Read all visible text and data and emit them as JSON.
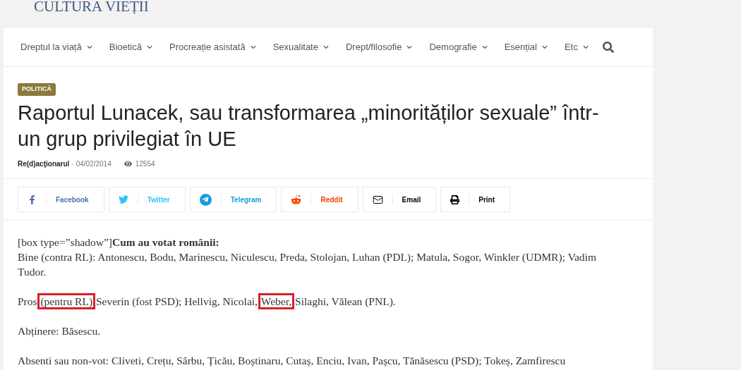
{
  "logo": "CULTURA VIEȚII",
  "nav": {
    "items": [
      {
        "label": "Dreptul la viață"
      },
      {
        "label": "Bioetică"
      },
      {
        "label": "Procreație asistată"
      },
      {
        "label": "Sexualitate"
      },
      {
        "label": "Drept/filosofie"
      },
      {
        "label": "Demografie"
      },
      {
        "label": "Esențial"
      },
      {
        "label": "Etc"
      }
    ]
  },
  "article": {
    "category": "POLITICĂ",
    "title": "Raportul Lunacek, sau transformarea „minorităților sexuale” într-un grup privilegiat în UE",
    "author": "Re(d)acţionarul",
    "separator": "-",
    "date": "04/02/2014",
    "views": "12554",
    "share": [
      {
        "kind": "facebook",
        "label": "Facebook",
        "color": "#516eab"
      },
      {
        "kind": "twitter",
        "label": "Twitter",
        "color": "#29c5f6"
      },
      {
        "kind": "telegram",
        "label": "Telegram",
        "color": "#179cde"
      },
      {
        "kind": "reddit",
        "label": "Reddit",
        "color": "#f54200"
      },
      {
        "kind": "email",
        "label": "Email",
        "color": "#000000"
      },
      {
        "kind": "print",
        "label": "Print",
        "color": "#000000"
      }
    ],
    "body": [
      {
        "lines": [
          "[box type=”shadow”]**Cum au votat românii:**",
          "Bine (contra RL): Antonescu, Bodu, Marinescu, Niculescu, Preda, Stolojan, Luhan (PDL); Matula, Sogor, Winkler (UDMR); Vadim Tudor."
        ]
      },
      {
        "segments": [
          {
            "text": "Pros",
            "highlighted": false
          },
          {
            "text": "(pentru RL)",
            "highlighted": true
          },
          {
            "text": "Severin (fost PSD); Hellvig, Nicolai,",
            "highlighted": false
          },
          {
            "text": "Weber,",
            "highlighted": true
          },
          {
            "text": "Silaghi, Vălean (PNL).",
            "highlighted": false
          }
        ]
      },
      {
        "lines": [
          "Abținere: Băsescu."
        ]
      },
      {
        "lines": [
          "Absenti sau non-vot: Cliveti, Crețu, Sârbu, Țicău, Boștinaru, Cutaș, Enciu, Ivan, Pașcu, Tănăsescu (PSD); Tokeș, Zamfirescu"
        ]
      }
    ]
  }
}
